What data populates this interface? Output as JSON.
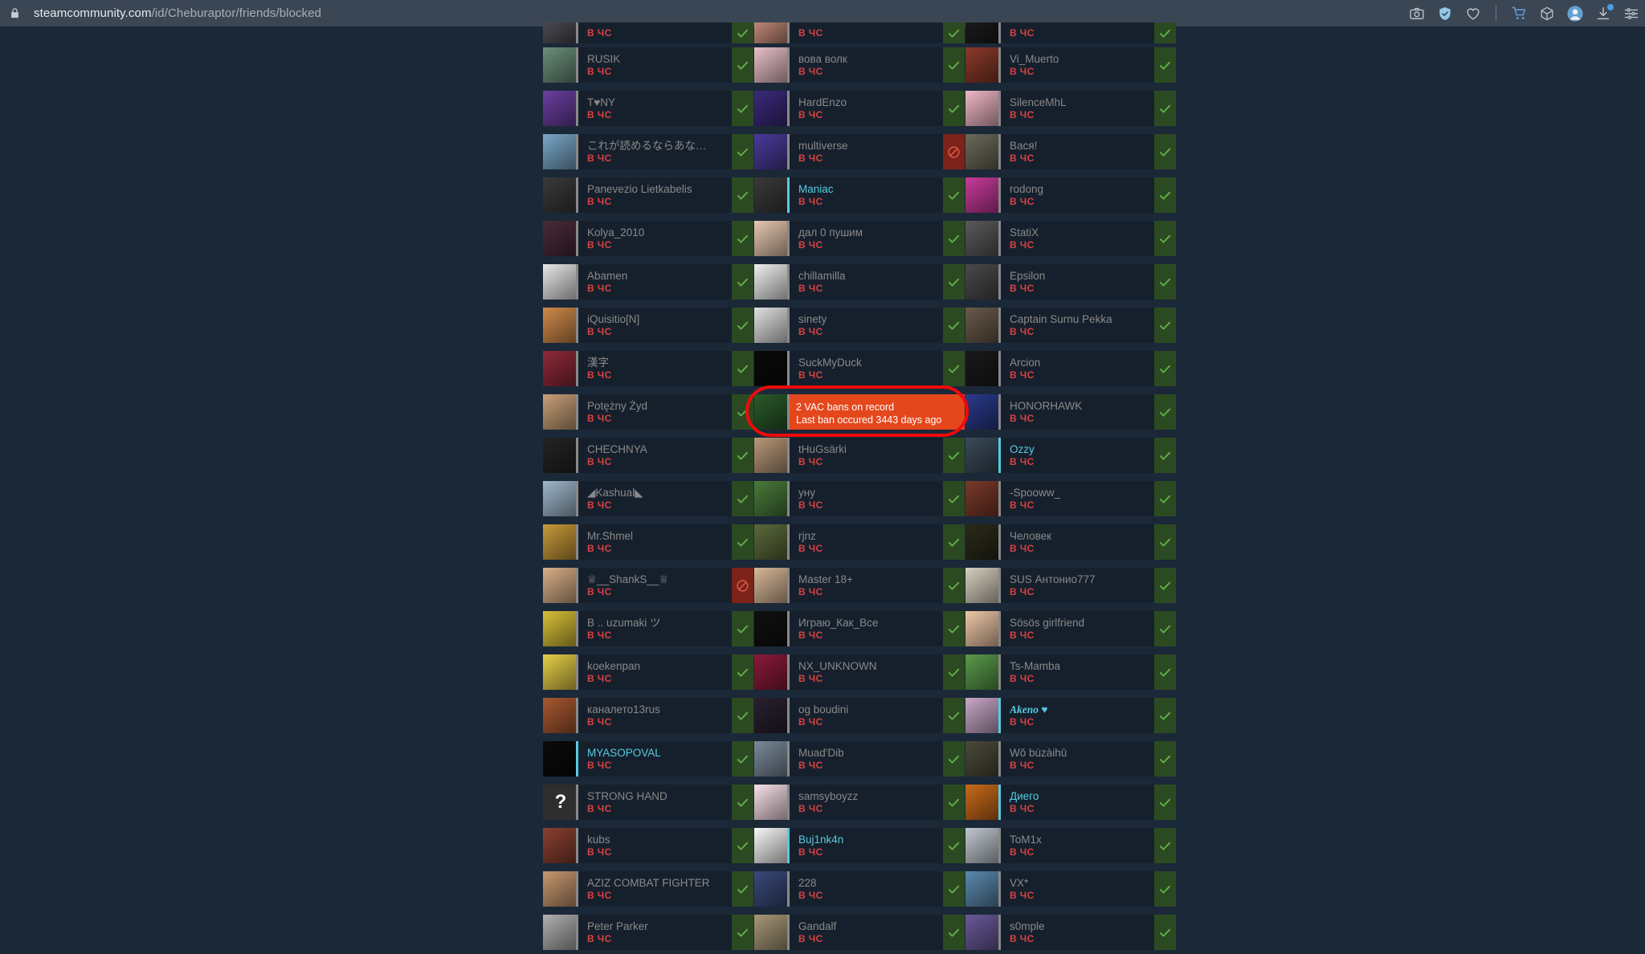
{
  "browser": {
    "url_domain": "steamcommunity.com",
    "url_path": "/id/Cheburaptor/friends/blocked",
    "lock_icon": "lock-icon",
    "toolbar_icons": [
      "camera-icon",
      "shield-check-icon",
      "heart-icon",
      "cart-icon",
      "box-icon",
      "account-avatar-icon",
      "download-icon",
      "settings-sliders-icon"
    ]
  },
  "labels": {
    "blocked_status": "В ЧС",
    "action_ok": "check-icon",
    "action_ban": "block-icon"
  },
  "vac_tooltip": {
    "line1": "2 VAC bans on record",
    "line2": "Last ban occured 3443 days ago",
    "bg_color": "#e5471d",
    "annotation_color": "#f00a0a"
  },
  "colors": {
    "page_bg": "#1b2838",
    "row_bg": "#16202d",
    "name_offline": "#898989",
    "name_online": "#57cbde",
    "status_red": "#d94141",
    "button_ok": "#2c4a22",
    "button_ban": "#7c2218"
  },
  "columns": [
    {
      "name": "column-left",
      "rows": [
        {
          "name": "",
          "status": "В ЧС",
          "action": "ok",
          "online": false,
          "partial": true,
          "avatar": "#4a4a52"
        },
        {
          "name": "RUSIK",
          "status": "В ЧС",
          "action": "ok",
          "online": false,
          "avatar": "#6b8f7a"
        },
        {
          "name": "T♥NY",
          "status": "В ЧС",
          "action": "ok",
          "online": false,
          "avatar": "#6b3fa0"
        },
        {
          "name": "これが読めるならあなたはゲ…",
          "status": "В ЧС",
          "action": "ok",
          "online": false,
          "avatar": "#7aa8c8"
        },
        {
          "name": "Panevezio Lietkabelis",
          "status": "В ЧС",
          "action": "ok",
          "online": false,
          "avatar": "#3a3a3a"
        },
        {
          "name": "Kolya_2010",
          "status": "В ЧС",
          "action": "ok",
          "online": false,
          "avatar": "#4a2a3a"
        },
        {
          "name": "Abamen",
          "status": "В ЧС",
          "action": "ok",
          "online": false,
          "avatar": "#e8e8e8"
        },
        {
          "name": "iQuisitio[N]",
          "status": "В ЧС",
          "action": "ok",
          "online": false,
          "avatar": "#d08a4a"
        },
        {
          "name": "漢字",
          "status": "В ЧС",
          "action": "ok",
          "online": false,
          "avatar": "#8f2a3a"
        },
        {
          "name": "Potężny Żyd",
          "status": "В ЧС",
          "action": "ok",
          "online": false,
          "avatar": "#c8a078"
        },
        {
          "name": "CHECHNYA",
          "status": "В ЧС",
          "action": "ok",
          "online": false,
          "avatar": "#242424"
        },
        {
          "name": "◢Kashual◣",
          "status": "В ЧС",
          "action": "ok",
          "online": false,
          "avatar": "#9fb8cc"
        },
        {
          "name": "Mr.Shmel",
          "status": "В ЧС",
          "action": "ok",
          "online": false,
          "avatar": "#c89a3a"
        },
        {
          "name": "♕__ShankS__♕",
          "status": "В ЧС",
          "action": "ban",
          "online": false,
          "avatar": "#d8b088"
        },
        {
          "name": "B .. uzumaki ツ",
          "status": "В ЧС",
          "action": "ok",
          "online": false,
          "avatar": "#d8c038"
        },
        {
          "name": "koekenpan",
          "status": "В ЧС",
          "action": "ok",
          "online": false,
          "avatar": "#e8d048"
        },
        {
          "name": "каналето13rus",
          "status": "В ЧС",
          "action": "ok",
          "online": false,
          "avatar": "#a85830"
        },
        {
          "name": "MYASOPOVAL",
          "status": "В ЧС",
          "action": "ok",
          "online": true,
          "avatar": "#0a0a0a"
        },
        {
          "name": "STRONG HAND",
          "status": "В ЧС",
          "action": "ok",
          "online": false,
          "avatar": "#333333",
          "qmark": true
        },
        {
          "name": "kubs",
          "status": "В ЧС",
          "action": "ok",
          "online": false,
          "avatar": "#8a4030"
        },
        {
          "name": "AZIZ COMBAT FIGHTER",
          "status": "В ЧС",
          "action": "ok",
          "online": false,
          "avatar": "#c89870"
        },
        {
          "name": "Peter Parker",
          "status": "В ЧС",
          "action": "ok",
          "online": false,
          "avatar": "#b0b0b0"
        }
      ]
    },
    {
      "name": "column-middle",
      "rows": [
        {
          "name": "",
          "status": "В ЧС",
          "action": "ok",
          "online": false,
          "partial": true,
          "avatar": "#c08878"
        },
        {
          "name": "вова волк",
          "status": "В ЧС",
          "action": "ok",
          "online": false,
          "avatar": "#e8c0c8"
        },
        {
          "name": "HardEnzo",
          "status": "В ЧС",
          "action": "ok",
          "online": false,
          "avatar": "#3a2a7a"
        },
        {
          "name": "multiverse",
          "status": "В ЧС",
          "action": "ban",
          "online": false,
          "avatar": "#4a3a9a"
        },
        {
          "name": "Maniac",
          "status": "В ЧС",
          "action": "ok",
          "online": true,
          "avatar": "#3a3a3a"
        },
        {
          "name": "дал 0 пушим",
          "status": "В ЧС",
          "action": "ok",
          "online": false,
          "avatar": "#e8c8b0"
        },
        {
          "name": "chillamilla",
          "status": "В ЧС",
          "action": "ok",
          "online": false,
          "avatar": "#f0f0f0"
        },
        {
          "name": "sinety",
          "status": "В ЧС",
          "action": "ok",
          "online": false,
          "avatar": "#e0e0e0"
        },
        {
          "name": "SuckMyDuck",
          "status": "В ЧС",
          "action": "ok",
          "online": false,
          "avatar": "#0a0a0a"
        },
        {
          "name": "",
          "status": "",
          "action": "none",
          "online": false,
          "avatar": "#2a5a2a",
          "vac": true
        },
        {
          "name": "tHuGsärki",
          "status": "В ЧС",
          "action": "ok",
          "online": false,
          "avatar": "#b89878"
        },
        {
          "name": "уну",
          "status": "В ЧС",
          "action": "ok",
          "online": false,
          "avatar": "#4a7a3a"
        },
        {
          "name": "rjnz",
          "status": "В ЧС",
          "action": "ok",
          "online": false,
          "avatar": "#5a6a3a"
        },
        {
          "name": "Master 18+",
          "status": "В ЧС",
          "action": "ok",
          "online": false,
          "avatar": "#d8b898"
        },
        {
          "name": "Играю_Как_Все",
          "status": "В ЧС",
          "action": "ok",
          "online": false,
          "avatar": "#101010"
        },
        {
          "name": "NX_UNKNOWN",
          "status": "В ЧС",
          "action": "ok",
          "online": false,
          "avatar": "#8a1a3a"
        },
        {
          "name": "og boudini",
          "status": "В ЧС",
          "action": "ok",
          "online": false,
          "avatar": "#2a2030"
        },
        {
          "name": "Muad'Dib",
          "status": "В ЧС",
          "action": "ok",
          "online": false,
          "avatar": "#7a8a9a"
        },
        {
          "name": "samsyboyzz",
          "status": "В ЧС",
          "action": "ok",
          "online": false,
          "avatar": "#f8e0e8"
        },
        {
          "name": "Buj1nk4n",
          "status": "В ЧС",
          "action": "ok",
          "online": true,
          "avatar": "#f8f8f8"
        },
        {
          "name": "228",
          "status": "В ЧС",
          "action": "ok",
          "online": false,
          "avatar": "#3a4a7a"
        },
        {
          "name": "Gandalf",
          "status": "В ЧС",
          "action": "ok",
          "online": false,
          "avatar": "#a89878"
        }
      ]
    },
    {
      "name": "column-right",
      "rows": [
        {
          "name": "",
          "status": "В ЧС",
          "action": "ok",
          "online": false,
          "partial": true,
          "avatar": "#1a1a1a"
        },
        {
          "name": "Vi_Muerto",
          "status": "В ЧС",
          "action": "ok",
          "online": false,
          "avatar": "#8a3a2a"
        },
        {
          "name": "SilenceMhL",
          "status": "В ЧС",
          "action": "ok",
          "online": false,
          "avatar": "#f0b8c8"
        },
        {
          "name": "Вася!",
          "status": "В ЧС",
          "action": "ok",
          "online": false,
          "avatar": "#6a6a5a"
        },
        {
          "name": "rodong",
          "status": "В ЧС",
          "action": "ok",
          "online": false,
          "avatar": "#c83a9a"
        },
        {
          "name": "StatiX",
          "status": "В ЧС",
          "action": "ok",
          "online": false,
          "avatar": "#5a5a5a"
        },
        {
          "name": "Epsilon",
          "status": "В ЧС",
          "action": "ok",
          "online": false,
          "avatar": "#4a4a4a"
        },
        {
          "name": "Captain Surnu Pekka",
          "status": "В ЧС",
          "action": "ok",
          "online": false,
          "avatar": "#6a5a4a"
        },
        {
          "name": "Arcion",
          "status": "В ЧС",
          "action": "ok",
          "online": false,
          "avatar": "#1a1a1a"
        },
        {
          "name": "HONORHAWK",
          "status": "В ЧС",
          "action": "ok",
          "online": false,
          "avatar": "#2a3a8a"
        },
        {
          "name": "Ozzy",
          "status": "В ЧС",
          "action": "ok",
          "online": true,
          "avatar": "#3a4a5a"
        },
        {
          "name": "-Spooww_",
          "status": "В ЧС",
          "action": "ok",
          "online": false,
          "avatar": "#7a3a2a"
        },
        {
          "name": "Человек",
          "status": "В ЧС",
          "action": "ok",
          "online": false,
          "avatar": "#2a2a1a"
        },
        {
          "name": "SUS Антонио777",
          "status": "В ЧС",
          "action": "ok",
          "online": false,
          "avatar": "#d8d0c0"
        },
        {
          "name": "Sösös girlfriend",
          "status": "В ЧС",
          "action": "ok",
          "online": false,
          "avatar": "#f0c8a8"
        },
        {
          "name": "Ts-Mamba",
          "status": "В ЧС",
          "action": "ok",
          "online": false,
          "avatar": "#5a9a4a"
        },
        {
          "name": "Akeno ♥",
          "status": "В ЧС",
          "action": "ok",
          "online": true,
          "fancy": true,
          "avatar": "#c8a8c8"
        },
        {
          "name": "Wǒ bùzàihū",
          "status": "В ЧС",
          "action": "ok",
          "online": false,
          "avatar": "#4a4a3a"
        },
        {
          "name": "Диего",
          "status": "В ЧС",
          "action": "ok",
          "online": true,
          "avatar": "#c86a1a"
        },
        {
          "name": "ToM1x",
          "status": "В ЧС",
          "action": "ok",
          "online": false,
          "avatar": "#c0c8d0"
        },
        {
          "name": "VX*",
          "status": "В ЧС",
          "action": "ok",
          "online": false,
          "avatar": "#5a8ab0"
        },
        {
          "name": "s0mple",
          "status": "В ЧС",
          "action": "ok",
          "online": false,
          "avatar": "#6a5a9a"
        }
      ]
    }
  ]
}
